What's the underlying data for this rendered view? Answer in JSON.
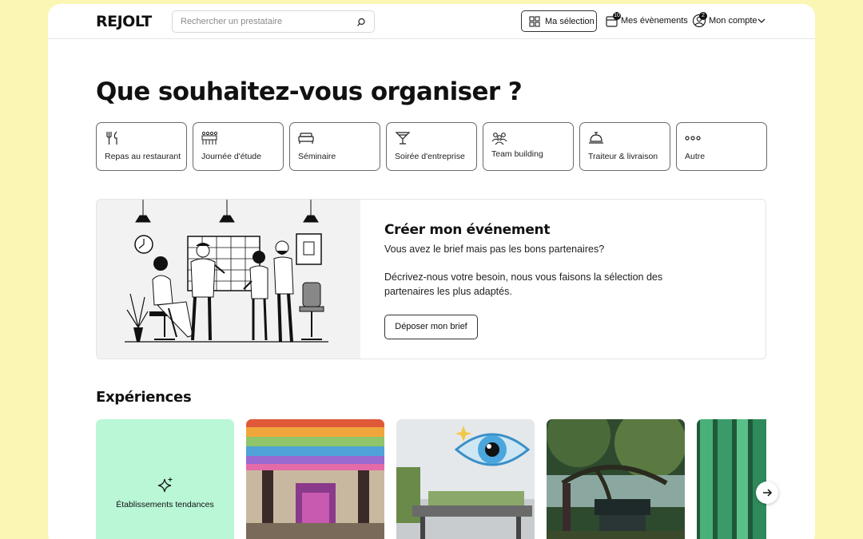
{
  "header": {
    "logo": "REJOLT",
    "search_placeholder": "Rechercher un prestataire",
    "selection_label": "Ma sélection",
    "events_label": "Mes évènements",
    "events_badge": "10",
    "account_label": "Mon compte",
    "account_badge": "2"
  },
  "hero": {
    "title": "Que souhaitez-vous organiser ?",
    "categories": [
      {
        "label": "Repas au restaurant",
        "icon": "fork-knife-icon"
      },
      {
        "label": "Journée d'étude",
        "icon": "group-seminar-icon"
      },
      {
        "label": "Séminaire",
        "icon": "bed-icon"
      },
      {
        "label": "Soirée d'entreprise",
        "icon": "cocktail-icon"
      },
      {
        "label": "Team building",
        "icon": "team-icon"
      },
      {
        "label": "Traiteur & livraison",
        "icon": "service-bell-icon"
      },
      {
        "label": "Autre",
        "icon": "more-dots-icon"
      }
    ]
  },
  "create_event": {
    "title": "Créer mon événement",
    "subtitle": "Vous avez le brief mais pas les bons partenaires?",
    "description": "Décrivez-nous votre besoin, nous vous faisons la sélection des partenaires les plus adaptés.",
    "button_label": "Déposer mon brief"
  },
  "experiences": {
    "title": "Expériences",
    "tiles": [
      {
        "label": "Établissements tendances",
        "color": "#b9f7d7"
      }
    ]
  },
  "colors": {
    "background": "#fbf6b4",
    "trend_tile": "#b9f7d7"
  }
}
